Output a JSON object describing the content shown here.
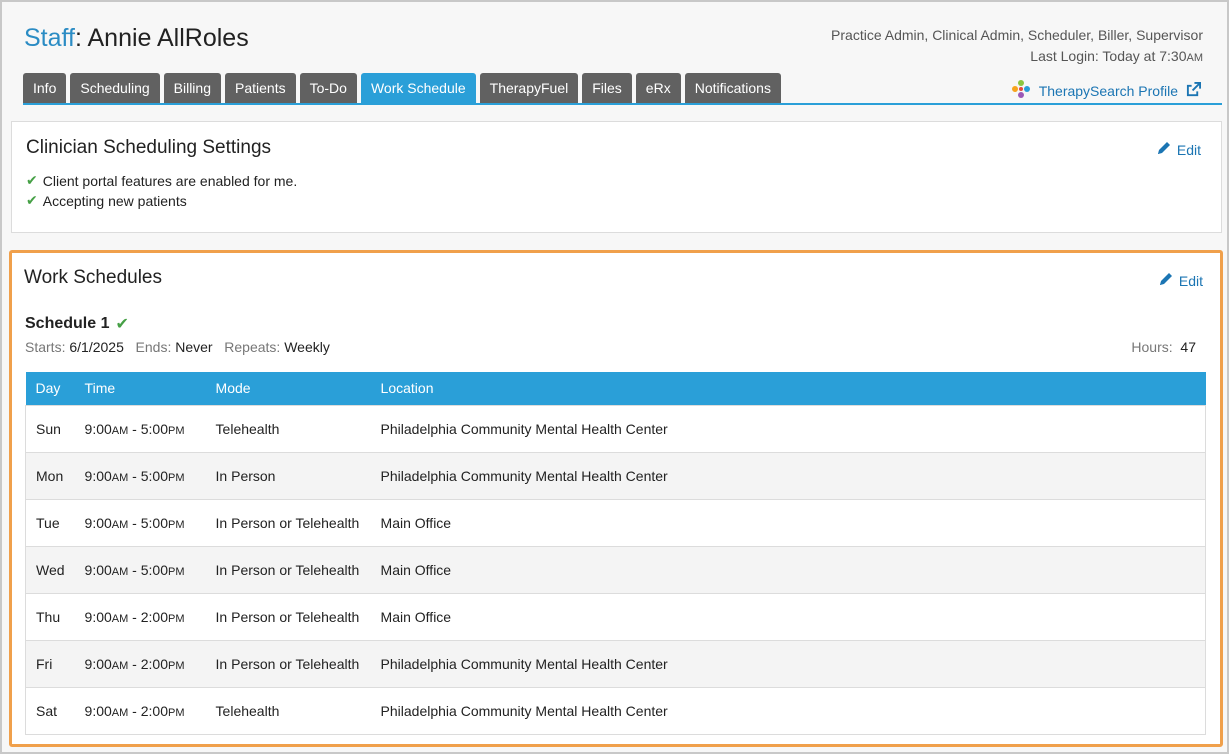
{
  "header": {
    "staff_label": "Staff",
    "staff_name": "Annie AllRoles",
    "roles": "Practice Admin, Clinical Admin, Scheduler, Biller, Supervisor",
    "last_login_prefix": "Last Login: Today at 7:30",
    "last_login_ampm": "AM"
  },
  "tabs": [
    {
      "label": "Info"
    },
    {
      "label": "Scheduling"
    },
    {
      "label": "Billing"
    },
    {
      "label": "Patients"
    },
    {
      "label": "To-Do"
    },
    {
      "label": "Work Schedule"
    },
    {
      "label": "TherapyFuel"
    },
    {
      "label": "Files"
    },
    {
      "label": "eRx"
    },
    {
      "label": "Notifications"
    }
  ],
  "active_tab": "Work Schedule",
  "therapysearch": {
    "label": "TherapySearch Profile"
  },
  "settings": {
    "title": "Clinician Scheduling Settings",
    "edit_label": "Edit",
    "items": [
      {
        "text": "Client portal features are enabled for me."
      },
      {
        "text": "Accepting new patients"
      }
    ]
  },
  "work_schedules": {
    "title": "Work Schedules",
    "edit_label": "Edit",
    "schedule_name": "Schedule 1",
    "starts_label": "Starts:",
    "starts_value": "6/1/2025",
    "ends_label": "Ends:",
    "ends_value": "Never",
    "repeats_label": "Repeats:",
    "repeats_value": "Weekly",
    "hours_label": "Hours:",
    "hours_value": "47",
    "columns": [
      "Day",
      "Time",
      "Mode",
      "Location"
    ],
    "rows": [
      {
        "day": "Sun",
        "start": "9:00",
        "start_ampm": "AM",
        "end": "5:00",
        "end_ampm": "PM",
        "mode": "Telehealth",
        "location": "Philadelphia Community Mental Health Center"
      },
      {
        "day": "Mon",
        "start": "9:00",
        "start_ampm": "AM",
        "end": "5:00",
        "end_ampm": "PM",
        "mode": "In Person",
        "location": "Philadelphia Community Mental Health Center"
      },
      {
        "day": "Tue",
        "start": "9:00",
        "start_ampm": "AM",
        "end": "5:00",
        "end_ampm": "PM",
        "mode": "In Person or Telehealth",
        "location": "Main Office"
      },
      {
        "day": "Wed",
        "start": "9:00",
        "start_ampm": "AM",
        "end": "5:00",
        "end_ampm": "PM",
        "mode": "In Person or Telehealth",
        "location": "Main Office"
      },
      {
        "day": "Thu",
        "start": "9:00",
        "start_ampm": "AM",
        "end": "2:00",
        "end_ampm": "PM",
        "mode": "In Person or Telehealth",
        "location": "Main Office"
      },
      {
        "day": "Fri",
        "start": "9:00",
        "start_ampm": "AM",
        "end": "2:00",
        "end_ampm": "PM",
        "mode": "In Person or Telehealth",
        "location": "Philadelphia Community Mental Health Center"
      },
      {
        "day": "Sat",
        "start": "9:00",
        "start_ampm": "AM",
        "end": "2:00",
        "end_ampm": "PM",
        "mode": "Telehealth",
        "location": "Philadelphia Community Mental Health Center"
      }
    ]
  },
  "colors": {
    "accent": "#2a9fd8",
    "tab_inactive": "#616161",
    "link": "#1b75b3",
    "check": "#46a046",
    "highlight_border": "#f0a04b"
  },
  "icons": {
    "edit": "pencil-icon",
    "external": "external-link-icon",
    "therapysearch": "therapysearch-logo-icon",
    "check": "checkmark-icon"
  }
}
